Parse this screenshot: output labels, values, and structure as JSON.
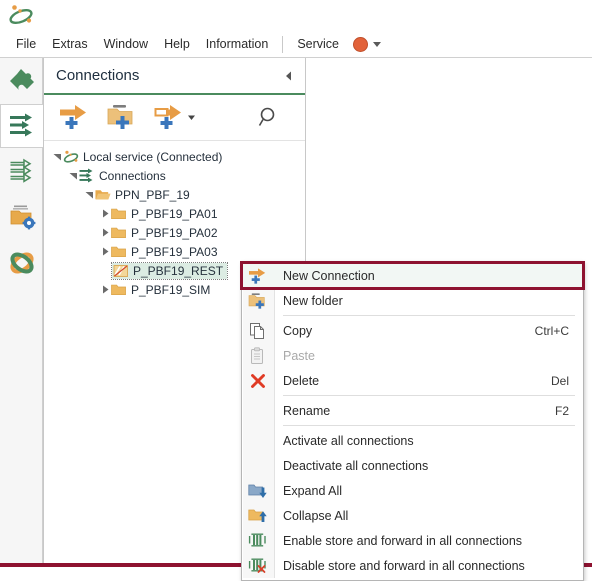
{
  "app": {
    "logo_icon": "app-logo-icon"
  },
  "menubar": {
    "items": [
      {
        "label": "File",
        "name": "menu-file"
      },
      {
        "label": "Extras",
        "name": "menu-extras"
      },
      {
        "label": "Window",
        "name": "menu-window"
      },
      {
        "label": "Help",
        "name": "menu-help"
      },
      {
        "label": "Information",
        "name": "menu-information"
      }
    ],
    "service_label": "Service",
    "service_status_color": "#e2623a",
    "service_dropdown_icon": "chevron-down-icon"
  },
  "rail": {
    "items": [
      {
        "name": "rail-item-puzzle",
        "icon": "puzzle-icon",
        "selected": false
      },
      {
        "name": "rail-item-connections",
        "icon": "connections-arrows-icon",
        "selected": true
      },
      {
        "name": "rail-item-flows",
        "icon": "flow-arrows-icon",
        "selected": false
      },
      {
        "name": "rail-item-configuration",
        "icon": "folder-gear-icon",
        "selected": false
      },
      {
        "name": "rail-item-sync",
        "icon": "sync-loop-icon",
        "selected": false
      }
    ]
  },
  "panel": {
    "title": "Connections",
    "collapse_icon": "collapse-left-icon",
    "toolbar": [
      {
        "name": "new-connection-button",
        "icon": "arrow-plus-icon",
        "tooltip": "New Connection"
      },
      {
        "name": "new-folder-button",
        "icon": "folder-plus-icon",
        "tooltip": "New folder"
      },
      {
        "name": "new-connection-from-template-button",
        "icon": "arrow-template-plus-icon",
        "tooltip": "New connection from template",
        "has_dropdown": true
      },
      {
        "name": "search-button",
        "icon": "search-icon",
        "tooltip": "Search"
      }
    ]
  },
  "tree": {
    "nodes": [
      {
        "name": "tree-node-local-service",
        "label": "Local service (Connected)",
        "icon": "service-node-icon",
        "depth": 0,
        "twisty": "expanded",
        "selected": false
      },
      {
        "name": "tree-node-connections",
        "label": "Connections",
        "icon": "connections-arrows-icon",
        "depth": 1,
        "twisty": "expanded",
        "selected": false
      },
      {
        "name": "tree-node-ppn-pbf-19",
        "label": "PPN_PBF_19",
        "icon": "folder-open-icon",
        "depth": 2,
        "twisty": "expanded",
        "selected": false
      },
      {
        "name": "tree-node-p-pbf19-pa01",
        "label": "P_PBF19_PA01",
        "icon": "folder-icon",
        "depth": 3,
        "twisty": "collapsed",
        "selected": false
      },
      {
        "name": "tree-node-p-pbf19-pa02",
        "label": "P_PBF19_PA02",
        "icon": "folder-icon",
        "depth": 3,
        "twisty": "collapsed",
        "selected": false
      },
      {
        "name": "tree-node-p-pbf19-pa03",
        "label": "P_PBF19_PA03",
        "icon": "folder-icon",
        "depth": 3,
        "twisty": "collapsed",
        "selected": false
      },
      {
        "name": "tree-node-p-pbf19-rest",
        "label": "P_PBF19_REST",
        "icon": "connection-inactive-icon",
        "depth": 3,
        "twisty": "none",
        "selected": true
      },
      {
        "name": "tree-node-p-pbf19-sim",
        "label": "P_PBF19_SIM",
        "icon": "folder-icon",
        "depth": 3,
        "twisty": "collapsed",
        "selected": false
      }
    ]
  },
  "context_menu": {
    "highlight_color": "#8e1230",
    "items": [
      {
        "name": "ctx-new-connection",
        "label": "New Connection",
        "shortcut": "",
        "icon": "arrow-plus-icon",
        "disabled": false,
        "highlighted": true,
        "separator_after": false
      },
      {
        "name": "ctx-new-folder",
        "label": "New folder",
        "shortcut": "",
        "icon": "folder-plus-icon",
        "disabled": false,
        "highlighted": false,
        "separator_after": true
      },
      {
        "name": "ctx-copy",
        "label": "Copy",
        "shortcut": "Ctrl+C",
        "icon": "copy-icon",
        "disabled": false,
        "highlighted": false,
        "separator_after": false
      },
      {
        "name": "ctx-paste",
        "label": "Paste",
        "shortcut": "",
        "icon": "paste-icon",
        "disabled": true,
        "highlighted": false,
        "separator_after": false
      },
      {
        "name": "ctx-delete",
        "label": "Delete",
        "shortcut": "Del",
        "icon": "delete-x-icon",
        "disabled": false,
        "highlighted": false,
        "separator_after": true
      },
      {
        "name": "ctx-rename",
        "label": "Rename",
        "shortcut": "F2",
        "icon": "",
        "disabled": false,
        "highlighted": false,
        "separator_after": true
      },
      {
        "name": "ctx-activate-all-connections",
        "label": "Activate all connections",
        "shortcut": "",
        "icon": "",
        "disabled": false,
        "highlighted": false,
        "separator_after": false
      },
      {
        "name": "ctx-deactivate-all-connections",
        "label": "Deactivate all connections",
        "shortcut": "",
        "icon": "",
        "disabled": false,
        "highlighted": false,
        "separator_after": false
      },
      {
        "name": "ctx-expand-all",
        "label": "Expand All",
        "shortcut": "",
        "icon": "expand-all-icon",
        "disabled": false,
        "highlighted": false,
        "separator_after": false
      },
      {
        "name": "ctx-collapse-all",
        "label": "Collapse All",
        "shortcut": "",
        "icon": "collapse-all-icon",
        "disabled": false,
        "highlighted": false,
        "separator_after": false
      },
      {
        "name": "ctx-enable-store-and-forward",
        "label": "Enable store and forward in all connections",
        "shortcut": "",
        "icon": "store-forward-enable-icon",
        "disabled": false,
        "highlighted": false,
        "separator_after": false
      },
      {
        "name": "ctx-disable-store-and-forward",
        "label": "Disable store and forward in all connections",
        "shortcut": "",
        "icon": "store-forward-disable-icon",
        "disabled": false,
        "highlighted": false,
        "separator_after": false
      }
    ]
  },
  "colors": {
    "accent_green": "#4b8b5e",
    "accent_orange": "#e79c45",
    "accent_blue": "#3a76bb",
    "highlight_red": "#8e1230",
    "selection_bg": "#dcece3"
  }
}
